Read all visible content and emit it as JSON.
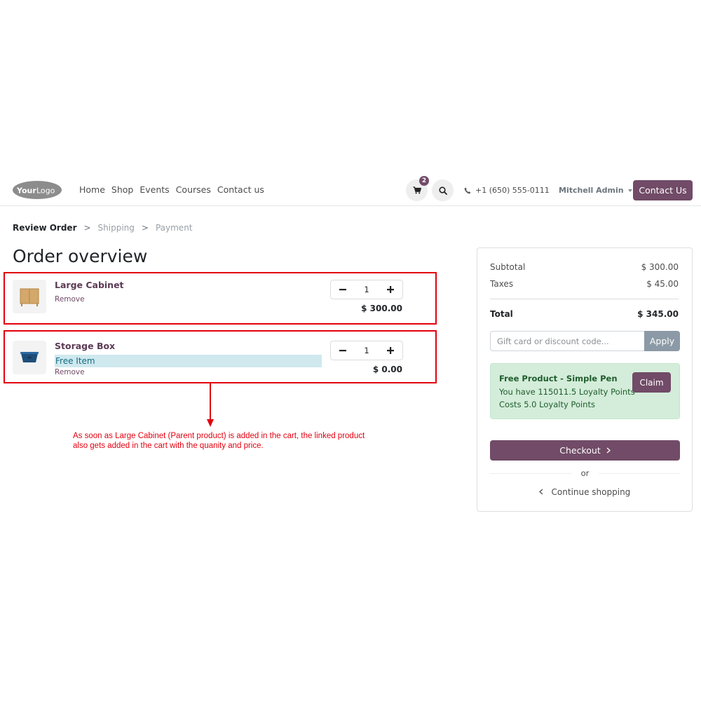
{
  "header": {
    "logo_text_bold": "Your",
    "logo_text_light": "Logo",
    "nav": [
      "Home",
      "Shop",
      "Events",
      "Courses",
      "Contact us"
    ],
    "cart_count": "2",
    "cart_icon": "shopping-cart-icon",
    "search_icon": "search-icon",
    "phone_icon": "phone-icon",
    "phone": "+1 (650) 555-0111",
    "user": "Mitchell Admin",
    "contact_button": "Contact Us",
    "accent_color": "#714b67"
  },
  "breadcrumb": {
    "steps": [
      "Review Order",
      "Shipping",
      "Payment"
    ],
    "separator": ">"
  },
  "page_title": "Order overview",
  "lines": [
    {
      "name": "Large Cabinet",
      "remove": "Remove",
      "quantity": "1",
      "price": "$ 300.00",
      "image_icon": "cabinet-image"
    },
    {
      "name": "Storage Box",
      "tag": "Free Item",
      "remove": "Remove",
      "quantity": "1",
      "price": "$ 0.00",
      "image_icon": "storage-box-image"
    }
  ],
  "annotation": {
    "text": "As soon as Large Cabinet (Parent product) is added in the cart, the linked product also gets added in the cart with the quanity and price.",
    "color": "#e3000f"
  },
  "summary": {
    "subtotal_label": "Subtotal",
    "subtotal_value": "$ 300.00",
    "taxes_label": "Taxes",
    "taxes_value": "$ 45.00",
    "total_label": "Total",
    "total_value": "$ 345.00",
    "promo_placeholder": "Gift card or discount code...",
    "apply_button": "Apply",
    "reward": {
      "title": "Free Product - Simple Pen",
      "points": "You have 115011.5 Loyalty Points",
      "cost": "Costs 5.0 Loyalty Points",
      "claim_button": "Claim"
    },
    "checkout_button": "Checkout",
    "or_text": "or",
    "continue_link": "Continue shopping"
  }
}
